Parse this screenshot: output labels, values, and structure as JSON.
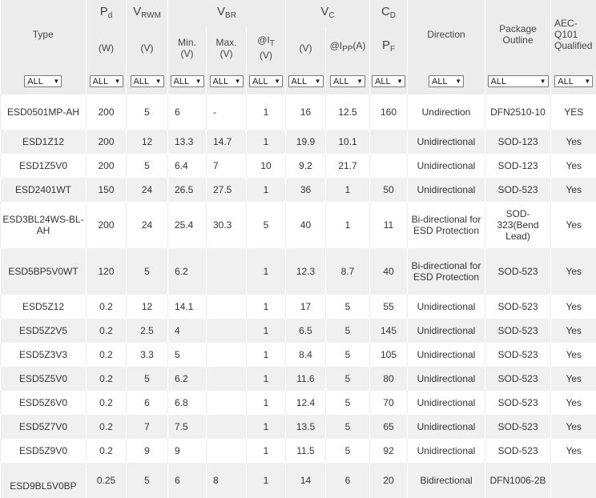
{
  "header": {
    "type": "Type",
    "pd_sym": "P",
    "pd_sub": "d",
    "pd_unit": "(W)",
    "vrwm_sym": "V",
    "vrwm_sub": "RWM",
    "vrwm_unit": "(V)",
    "vbr_sym": "V",
    "vbr_sub": "BR",
    "vbr_min": "Min.",
    "vbr_min_unit": "(V)",
    "vbr_max": "Max.",
    "vbr_max_unit": "(V)",
    "vbr_it_pre": "@I",
    "vbr_it_sub": "T",
    "vbr_it_unit": "(V)",
    "vc_sym": "V",
    "vc_sub": "C",
    "vc_unit": "(V)",
    "vc_ipp_pre": "@I",
    "vc_ipp_sub": "PP",
    "vc_ipp_unit": "(A)",
    "cd_sym": "C",
    "cd_sub": "D",
    "cd_pf_sym": "P",
    "cd_pf_sub": "F",
    "direction": "Direction",
    "package": "Package Outline",
    "aec": "AEC-Q101 Qualified"
  },
  "filters": {
    "type": "ALL",
    "pd": "ALL",
    "vrwm": "ALL",
    "vbr_min": "ALL",
    "vbr_max": "ALL",
    "vbr_it": "ALL",
    "vc": "ALL",
    "vc_ipp": "ALL",
    "cd": "ALL",
    "direction": "ALL",
    "package": "ALL",
    "aec": "ALL"
  },
  "rows": [
    {
      "type": "ESD0501MP-AH",
      "pd": "200",
      "vrwm": "5",
      "vbr_min": "6",
      "vbr_max": "-",
      "it": "1",
      "vc": "16",
      "ipp": "12.5",
      "cd": "160",
      "direction": "Undirection",
      "package": "DFN2510-10",
      "aec": "YES"
    },
    {
      "type": "ESD1Z12",
      "pd": "200",
      "vrwm": "12",
      "vbr_min": "13.3",
      "vbr_max": "14.7",
      "it": "1",
      "vc": "19.9",
      "ipp": "10.1",
      "cd": "",
      "direction": "Unidirectional",
      "package": "SOD-123",
      "aec": "Yes"
    },
    {
      "type": "ESD1Z5V0",
      "pd": "200",
      "vrwm": "5",
      "vbr_min": "6.4",
      "vbr_max": "7",
      "it": "10",
      "vc": "9.2",
      "ipp": "21.7",
      "cd": "",
      "direction": "Unidirectional",
      "package": "SOD-123",
      "aec": "Yes"
    },
    {
      "type": "ESD2401WT",
      "pd": "150",
      "vrwm": "24",
      "vbr_min": "26.5",
      "vbr_max": "27.5",
      "it": "1",
      "vc": "36",
      "ipp": "1",
      "cd": "50",
      "direction": "Unidirectional",
      "package": "SOD-523",
      "aec": "Yes"
    },
    {
      "type": "ESD3BL24WS-BL-AH",
      "pd": "200",
      "vrwm": "24",
      "vbr_min": "25.4",
      "vbr_max": "30.3",
      "it": "5",
      "vc": "40",
      "ipp": "1",
      "cd": "11",
      "direction": "Bi-directional for ESD Protection",
      "package": "SOD-323(Bend Lead)",
      "aec": "Yes"
    },
    {
      "type": "ESD5BP5V0WT",
      "pd": "120",
      "vrwm": "5",
      "vbr_min": "6.2",
      "vbr_max": "",
      "it": "1",
      "vc": "12.3",
      "ipp": "8.7",
      "cd": "40",
      "direction": "Bi-directional for ESD Protection",
      "package": "SOD-523",
      "aec": "Yes"
    },
    {
      "type": "ESD5Z12",
      "pd": "0.2",
      "vrwm": "12",
      "vbr_min": "14.1",
      "vbr_max": "",
      "it": "1",
      "vc": "17",
      "ipp": "5",
      "cd": "55",
      "direction": "Unidirectional",
      "package": "SOD-523",
      "aec": "Yes"
    },
    {
      "type": "ESD5Z2V5",
      "pd": "0.2",
      "vrwm": "2.5",
      "vbr_min": "4",
      "vbr_max": "",
      "it": "1",
      "vc": "6.5",
      "ipp": "5",
      "cd": "145",
      "direction": "Unidirectional",
      "package": "SOD-523",
      "aec": "Yes"
    },
    {
      "type": "ESD5Z3V3",
      "pd": "0.2",
      "vrwm": "3.3",
      "vbr_min": "5",
      "vbr_max": "",
      "it": "1",
      "vc": "8.4",
      "ipp": "5",
      "cd": "105",
      "direction": "Unidirectional",
      "package": "SOD-523",
      "aec": "Yes"
    },
    {
      "type": "ESD5Z5V0",
      "pd": "0.2",
      "vrwm": "5",
      "vbr_min": "6.2",
      "vbr_max": "",
      "it": "1",
      "vc": "11.6",
      "ipp": "5",
      "cd": "80",
      "direction": "Unidirectional",
      "package": "SOD-523",
      "aec": "Yes"
    },
    {
      "type": "ESD5Z6V0",
      "pd": "0.2",
      "vrwm": "6",
      "vbr_min": "6.8",
      "vbr_max": "",
      "it": "1",
      "vc": "12.4",
      "ipp": "5",
      "cd": "70",
      "direction": "Unidirectional",
      "package": "SOD-523",
      "aec": "Yes"
    },
    {
      "type": "ESD5Z7V0",
      "pd": "0.2",
      "vrwm": "7",
      "vbr_min": "7.5",
      "vbr_max": "",
      "it": "1",
      "vc": "13.5",
      "ipp": "5",
      "cd": "65",
      "direction": "Unidirectional",
      "package": "SOD-523",
      "aec": "Yes"
    },
    {
      "type": "ESD5Z9V0",
      "pd": "0.2",
      "vrwm": "9",
      "vbr_min": "9",
      "vbr_max": "",
      "it": "1",
      "vc": "11.5",
      "ipp": "5",
      "cd": "92",
      "direction": "Unidirectional",
      "package": "SOD-523",
      "aec": "Yes"
    },
    {
      "type": "ESD9BL5V0BP",
      "pd": "0.25",
      "vrwm": "5",
      "vbr_min": "6",
      "vbr_max": "8",
      "it": "1",
      "vc": "14",
      "ipp": "6",
      "cd": "20",
      "direction": "Bidirectional",
      "package": "DFN1006-2B",
      "aec": ""
    }
  ]
}
